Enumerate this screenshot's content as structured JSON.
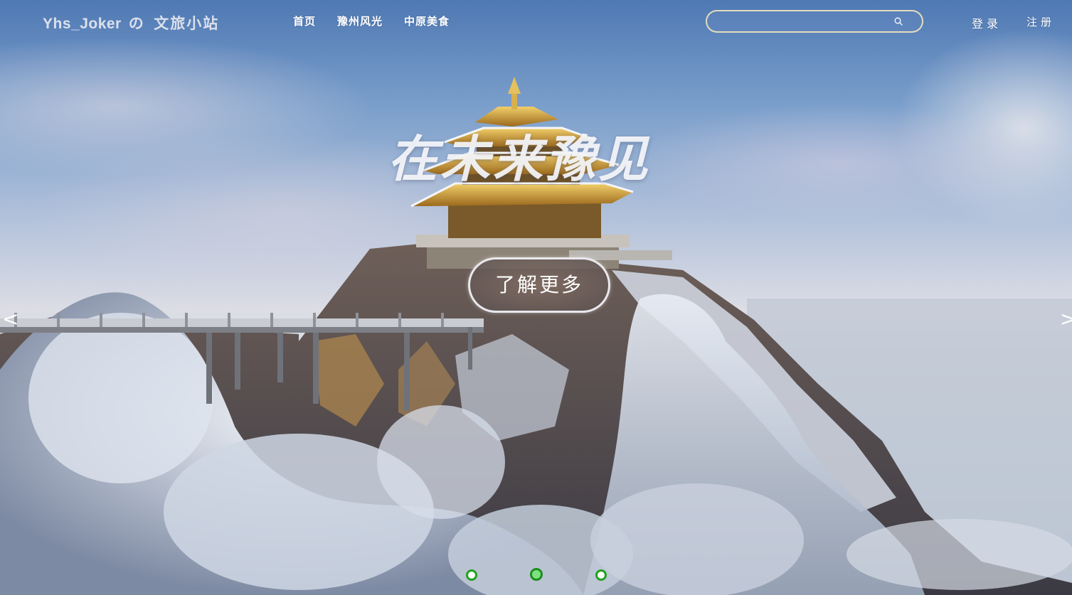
{
  "nav": {
    "brand_name": "Yhs_Joker",
    "brand_sep": "の",
    "brand_site": "文旅小站",
    "menu": [
      "首页",
      "豫州风光",
      "中原美食"
    ],
    "search_placeholder": "",
    "search_value": "",
    "login": "登录",
    "register": "注册"
  },
  "hero": {
    "headline": "在未来豫见",
    "cta": "了解更多",
    "prev_arrow": "<",
    "next_arrow": ">"
  },
  "carousel": {
    "slide_count": 3,
    "active_index": 1
  },
  "colors": {
    "dot_border": "#1fa31f",
    "dot_active_fill": "#7ee07e",
    "search_border": "#ebe1be"
  },
  "icons": {
    "search": "search-icon"
  }
}
